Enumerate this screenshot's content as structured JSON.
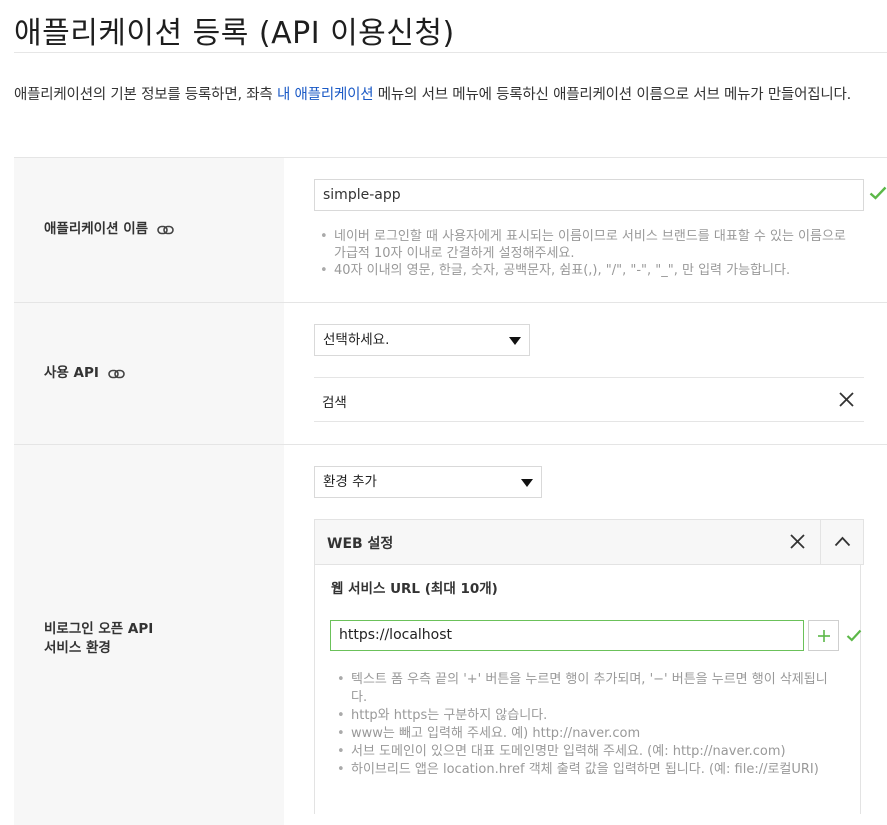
{
  "page": {
    "title": "애플리케이션 등록 (API 이용신청)",
    "intro_before": "애플리케이션의 기본 정보를 등록하면, 좌측 ",
    "intro_link": "내 애플리케이션",
    "intro_after": " 메뉴의 서브 메뉴에 등록하신 애플리케이션 이름으로 서브 메뉴가 만들어집니다."
  },
  "app_name": {
    "label": "애플리케이션 이름",
    "value": "simple-app",
    "hints": [
      "네이버 로그인할 때 사용자에게 표시되는 이름이므로 서비스 브랜드를 대표할 수 있는 이름으로 가급적 10자 이내로 간결하게 설정해주세요.",
      "40자 이내의 영문, 한글, 숫자, 공백문자, 쉼표(,), \"/\", \"-\", \"_\", 만 입력 가능합니다."
    ]
  },
  "api": {
    "label": "사용 API",
    "select_placeholder": "선택하세요.",
    "selected_item": "검색"
  },
  "env": {
    "label_line1": "비로그인 오픈 API",
    "label_line2": "서비스 환경",
    "select_label": "환경 추가",
    "web_title": "WEB 설정",
    "url_label": "웹 서비스 URL (최대 10개)",
    "url_value": "https://localhost",
    "hints": [
      "텍스트 폼 우측 끝의 '+' 버튼을 누르면 행이 추가되며, '−' 버튼을 누르면 행이 삭제됩니다.",
      "http와 https는 구분하지 않습니다.",
      "www는 빼고 입력해 주세요. 예) http://naver.com",
      "서브 도메인이 있으면 대표 도메인명만 입력해 주세요. (예: http://naver.com)",
      "하이브리드 앱은 location.href 객체 출력 값을 입력하면 됩니다. (예: file://로컬URI)"
    ]
  },
  "colors": {
    "accent_link": "#1b5ac6",
    "valid_green": "#5cb848",
    "label_bg": "#f7f7f7"
  },
  "icons": [
    "link-icon",
    "checkmark-icon",
    "dropdown-arrow-icon",
    "close-icon",
    "chevron-up-icon",
    "plus-icon"
  ]
}
